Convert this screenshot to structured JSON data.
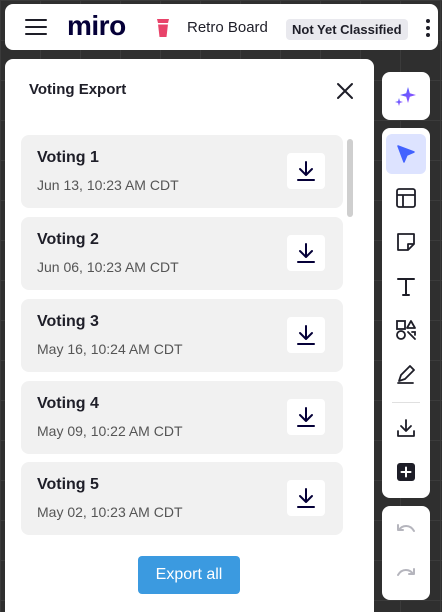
{
  "topbar": {
    "logo": "miro",
    "board_title": "Retro Board",
    "badge": "Not Yet Classified"
  },
  "panel": {
    "title": "Voting Export",
    "items": [
      {
        "name": "Voting 1",
        "date": "Jun 13, 10:23 AM CDT"
      },
      {
        "name": "Voting 2",
        "date": "Jun 06, 10:23 AM CDT"
      },
      {
        "name": "Voting 3",
        "date": "May 16, 10:24 AM CDT"
      },
      {
        "name": "Voting 4",
        "date": "May 09, 10:22 AM CDT"
      },
      {
        "name": "Voting 5",
        "date": "May 02, 10:23 AM CDT"
      }
    ],
    "export_all_label": "Export all"
  },
  "toolbar": {
    "tools": [
      "ai-sparkle-icon",
      "select-cursor-icon",
      "table-icon",
      "sticky-note-icon",
      "text-icon",
      "shapes-icon",
      "pen-icon",
      "download-icon",
      "add-icon"
    ],
    "active_tool": "select-cursor-icon",
    "history": [
      "undo-icon",
      "redo-icon"
    ]
  },
  "colors": {
    "accent": "#4262ff",
    "export_button": "#3b9ae0",
    "board_icon": "#e8436a",
    "canvas": "#2f2f2f"
  }
}
